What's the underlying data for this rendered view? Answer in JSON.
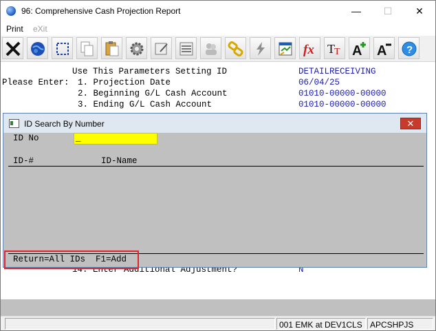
{
  "window": {
    "title": "96: Comprehensive Cash Projection Report",
    "minimize": "—",
    "maximize": "☐",
    "close": "✕"
  },
  "menu": {
    "print": "Print",
    "exit": "eXit"
  },
  "toolbar": [
    "close-x-icon",
    "globe-icon",
    "select-icon",
    "copy-icon",
    "paste-icon",
    "settings-gear-icon",
    "edit-form-icon",
    "list-icon",
    "users-icon",
    "link-chain-icon",
    "lightning-icon",
    "report-icon",
    "function-fx-icon",
    "font-tt-icon",
    "font-increase-icon",
    "font-decrease-icon",
    "help-icon"
  ],
  "terminal": {
    "line0_label": "Use This Parameters Setting ID",
    "line0_value": "DETAILRECEIVING",
    "prompt": "Please Enter:",
    "line1_label": "1. Projection Date",
    "line1_value": "06/04/25",
    "line2_label": "2. Beginning G/L Cash Account",
    "line2_value": "01010-00000-00000",
    "line3_label": "3. Ending G/L Cash Account",
    "line3_value": "01010-00000-00000",
    "line14_label": "14. Enter Additional Adjustment?",
    "line14_value": "N"
  },
  "dialog": {
    "title": "ID Search By Number",
    "close": "✕",
    "id_label": "ID No",
    "id_value": "_",
    "col_id": "ID-#",
    "col_name": "ID-Name",
    "footer": "Return=All IDs  F1=Add"
  },
  "status": {
    "cell1": "",
    "cell2": "001 EMK at DEV1CLS",
    "cell3": "APCSHPJS"
  }
}
